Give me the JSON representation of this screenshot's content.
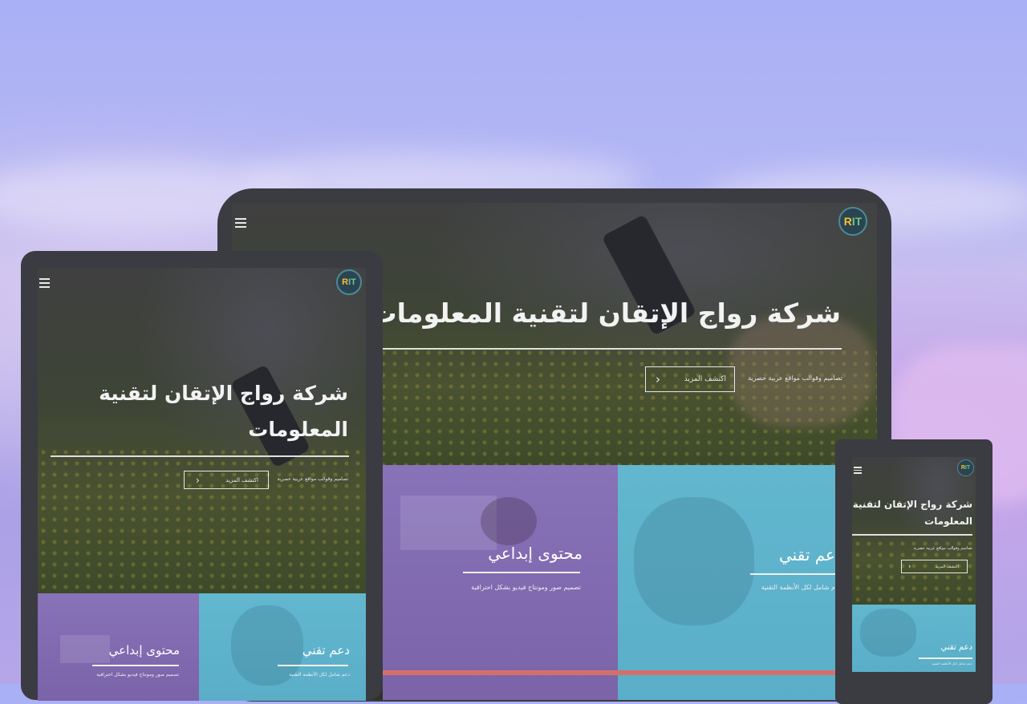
{
  "brand": {
    "logo_text_r": "R",
    "logo_text_it": "IT"
  },
  "hero": {
    "title": "شركة رواج الإتقان لتقنية المعلومات",
    "title_line1": "شركة رواج الإتقان لتقنية",
    "title_line2": "المعلومات",
    "tagline": "تصاميم وقوالب مواقع عربية حصرية",
    "cta_label": "اكتشف المزيد",
    "cta_icon": "chevron-left-icon"
  },
  "cards": {
    "creative": {
      "title": "محتوى إبداعي",
      "desc": "تصميم صور ومونتاج فيديو بشكل احترافية"
    },
    "support": {
      "title": "دعم تقني",
      "title_cut": "عم تقني",
      "desc": "دعم شامل لكل الأنظمة التقنية",
      "desc_cut": "م شامل لكل الأنظمة التقنية"
    }
  },
  "colors": {
    "background": "#aab0f5",
    "device_frame": "#3b3b42",
    "creative_card": "#8872b8",
    "support_card": "#62b7cf",
    "accent_bar": "#d4706a"
  }
}
